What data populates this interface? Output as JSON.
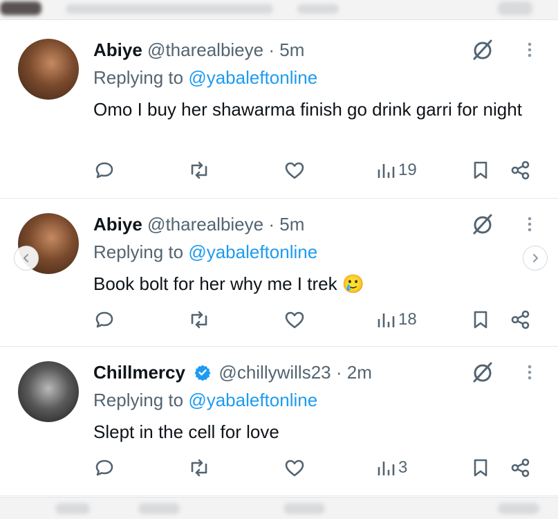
{
  "tweets": [
    {
      "name": "Abiye",
      "verified": false,
      "handle": "@tharealbieye",
      "separator": "·",
      "time": "5m",
      "replying_prefix": "Replying to",
      "replying_to": "@yabaleftonline",
      "text": "Omo I buy her shawarma finish go drink garri for night",
      "counts": {
        "views": "19"
      }
    },
    {
      "name": "Abiye",
      "verified": false,
      "handle": "@tharealbieye",
      "separator": "·",
      "time": "5m",
      "replying_prefix": "Replying to",
      "replying_to": "@yabaleftonline",
      "text": "Book bolt for her why me I trek 🥲",
      "counts": {
        "views": "18"
      }
    },
    {
      "name": "Chillmercy",
      "verified": true,
      "handle": "@chillywills23",
      "separator": "·",
      "time": "2m",
      "replying_prefix": "Replying to",
      "replying_to": "@yabaleftonline",
      "text": "Slept in the cell for love",
      "counts": {
        "views": "3"
      }
    }
  ],
  "icons": {
    "reply": "reply-icon",
    "retweet": "retweet-icon",
    "like": "heart-icon",
    "views": "views-icon",
    "bookmark": "bookmark-icon",
    "share": "share-icon",
    "grok": "grok-icon",
    "more": "more-icon",
    "verified": "verified-badge-icon",
    "prev": "chevron-left-icon",
    "next": "chevron-right-icon"
  },
  "colors": {
    "mention": "#1d9bf0",
    "secondary_text": "#536471",
    "verified": "#1d9bf0"
  }
}
